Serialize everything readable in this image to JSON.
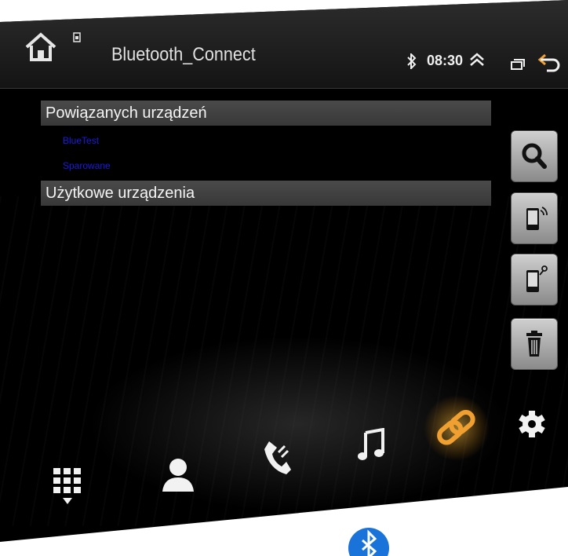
{
  "statusbar": {
    "title": "Bluetooth_Connect",
    "time": "08:30",
    "icons": [
      "home-icon",
      "sim-icon",
      "bluetooth-icon",
      "chevron-up-icon",
      "window-icon",
      "back-icon"
    ]
  },
  "paired": {
    "header": "Powiązanych urządzeń",
    "device_name": "BlueTest",
    "device_status": "Sparowane"
  },
  "available": {
    "header": "Użytkowe urządzenia"
  },
  "side_buttons": [
    "search-icon",
    "phone-signal-icon",
    "phone-link-icon",
    "trash-icon"
  ],
  "bottom_nav": [
    "dialpad-icon",
    "contacts-icon",
    "call-log-icon",
    "music-icon",
    "link-icon",
    "settings-icon"
  ],
  "colors": {
    "accent": "#f0a030",
    "device_text": "#1a1ae0",
    "header_bg": "#404040"
  }
}
